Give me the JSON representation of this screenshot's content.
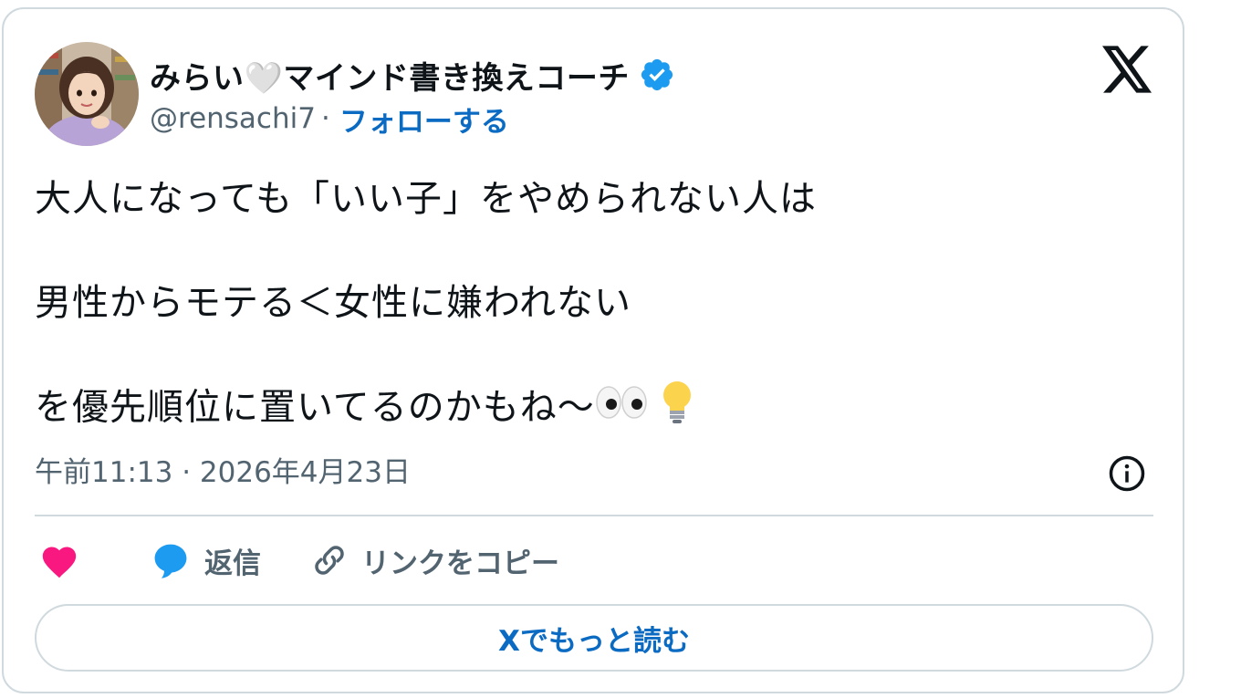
{
  "author": {
    "display_name": "みらい🤍マインド書き換えコーチ",
    "handle": "@rensachi7",
    "separator": "·",
    "follow_label": "フォローする",
    "verified": true
  },
  "tweet": {
    "lines": [
      "大人になっても「いい子」をやめられない人は",
      "男性からモテる＜女性に嫌われない",
      "を優先順位に置いてるのかもね〜"
    ],
    "trailing_emojis": [
      "eyes-emoji",
      "light-bulb-emoji"
    ]
  },
  "timestamp": "午前11:13 · 2026年4月23日",
  "actions": {
    "reply_label": "返信",
    "copy_link_label": "リンクをコピー"
  },
  "read_more_label": "Xでもっと読む",
  "colors": {
    "link_blue": "#0b6bc2",
    "verified_blue": "#1d9bf0",
    "like_pink": "#f91880",
    "reply_blue": "#1d9bf0",
    "border": "#cfd9de",
    "secondary_text": "#536471"
  },
  "icons": [
    "avatar",
    "verified-badge-icon",
    "x-logo-icon",
    "info-icon",
    "heart-icon",
    "reply-bubble-icon",
    "link-icon"
  ]
}
